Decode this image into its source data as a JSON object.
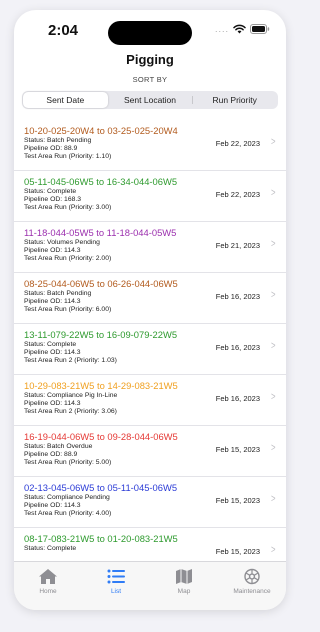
{
  "status_bar": {
    "time": "2:04",
    "signal": "....",
    "wifi_icon": "wifi-icon",
    "battery_icon": "battery-icon"
  },
  "header": {
    "title": "Pigging",
    "sort_label": "SORT BY"
  },
  "sort_segments": [
    {
      "label": "Sent Date",
      "selected": true
    },
    {
      "label": "Sent Location",
      "selected": false
    },
    {
      "label": "Run Priority",
      "selected": false
    }
  ],
  "items": [
    {
      "route": "10-20-025-20W4 to 03-25-025-20W4",
      "color": "#b25b1e",
      "status": "Status: Batch Pending",
      "pipeline": "Pipeline OD: 88.9",
      "run": "Test Area Run  (Priority: 1.10)",
      "date": "Feb 22, 2023"
    },
    {
      "route": "05-11-045-06W5 to 16-34-044-06W5",
      "color": "#2e9a2e",
      "status": "Status: Complete",
      "pipeline": "Pipeline OD: 168.3",
      "run": "Test Area Run  (Priority: 3.00)",
      "date": "Feb 22, 2023"
    },
    {
      "route": "11-18-044-05W5 to 11-18-044-05W5",
      "color": "#9b2fae",
      "status": "Status: Volumes Pending",
      "pipeline": "Pipeline OD: 114.3",
      "run": "Test Area Run  (Priority: 2.00)",
      "date": "Feb 21, 2023"
    },
    {
      "route": "08-25-044-06W5 to 06-26-044-06W5",
      "color": "#b25b1e",
      "status": "Status: Batch Pending",
      "pipeline": "Pipeline OD: 114.3",
      "run": "Test Area Run  (Priority: 6.00)",
      "date": "Feb 16, 2023"
    },
    {
      "route": "13-11-079-22W5 to 16-09-079-22W5",
      "color": "#2e9a2e",
      "status": "Status: Complete",
      "pipeline": "Pipeline OD: 114.3",
      "run": "Test Area Run 2  (Priority: 1.03)",
      "date": "Feb 16, 2023"
    },
    {
      "route": "10-29-083-21W5 to 14-29-083-21W5",
      "color": "#f0a020",
      "status": "Status: Compliance Pig In-Line",
      "pipeline": "Pipeline OD: 114.3",
      "run": "Test Area Run 2  (Priority: 3.06)",
      "date": "Feb 16, 2023"
    },
    {
      "route": "16-19-044-06W5 to 09-28-044-06W5",
      "color": "#e53935",
      "status": "Status: Batch Overdue",
      "pipeline": "Pipeline OD: 88.9",
      "run": "Test Area Run  (Priority: 5.00)",
      "date": "Feb 15, 2023"
    },
    {
      "route": "02-13-045-06W5 to 05-11-045-06W5",
      "color": "#2b3bd6",
      "status": "Status: Compliance Pending",
      "pipeline": "Pipeline OD: 114.3",
      "run": "Test Area Run  (Priority: 4.00)",
      "date": "Feb 15, 2023"
    },
    {
      "route": "08-17-083-21W5 to 01-20-083-21W5",
      "color": "#2e9a2e",
      "status": "Status: Complete",
      "pipeline": "",
      "run": "",
      "date": "Feb 15, 2023"
    }
  ],
  "tabs": [
    {
      "label": "Home",
      "icon": "home-icon",
      "active": false
    },
    {
      "label": "List",
      "icon": "list-icon",
      "active": true
    },
    {
      "label": "Map",
      "icon": "map-icon",
      "active": false
    },
    {
      "label": "Maintenance",
      "icon": "gear-icon",
      "active": false
    }
  ],
  "colors": {
    "accent": "#2f7cf6",
    "inactive_tab": "#8e8e93"
  }
}
